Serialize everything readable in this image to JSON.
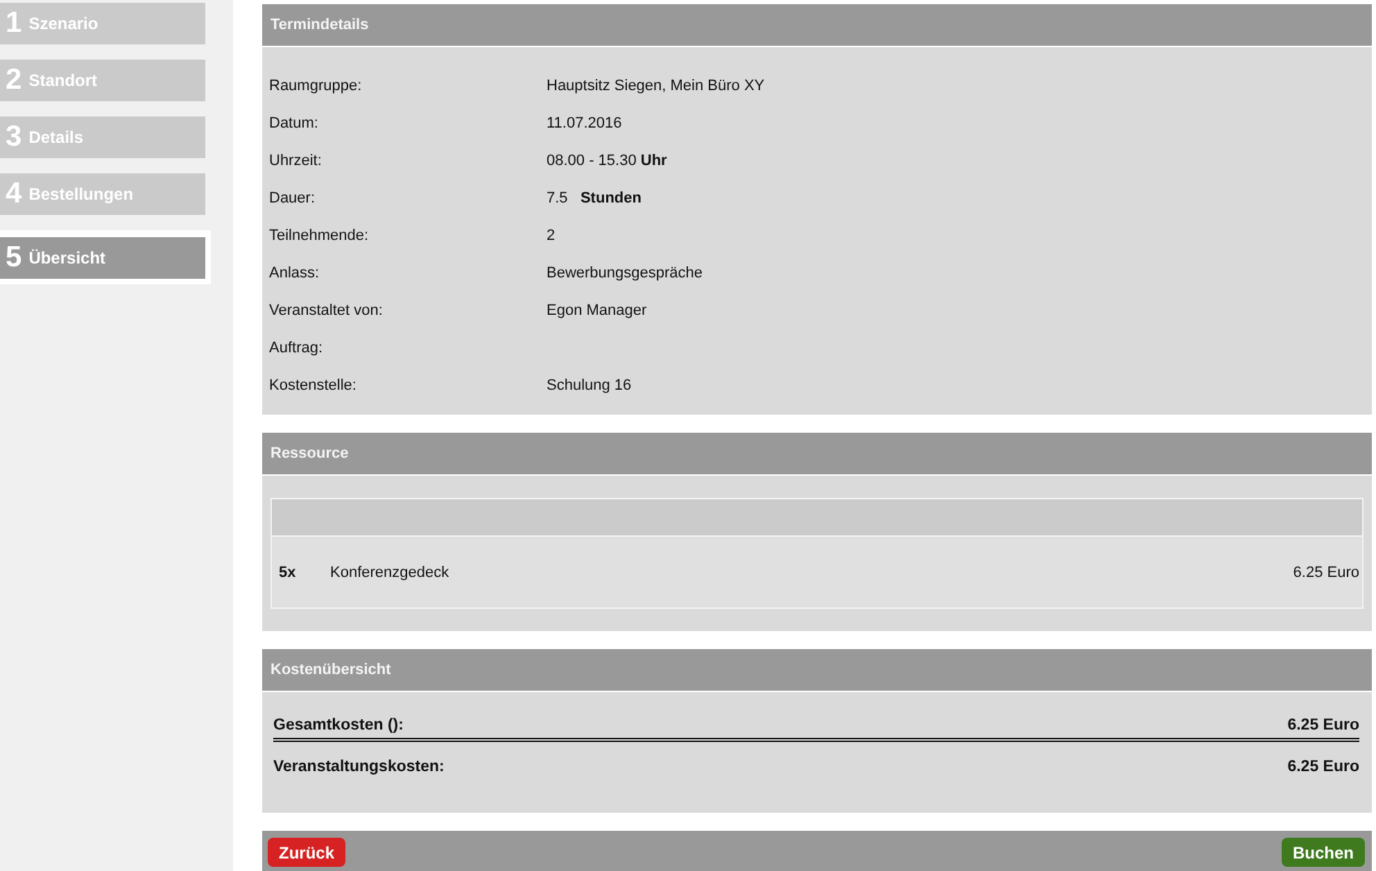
{
  "steps": [
    {
      "number": "1",
      "label": "Szenario",
      "selected": false
    },
    {
      "number": "2",
      "label": "Standort",
      "selected": false
    },
    {
      "number": "3",
      "label": "Details",
      "selected": false
    },
    {
      "number": "4",
      "label": "Bestellungen",
      "selected": false
    },
    {
      "number": "5",
      "label": "Übersicht",
      "selected": true
    }
  ],
  "termindetails": {
    "title": "Termindetails",
    "rows": [
      {
        "label": "Raumgruppe:",
        "value": "Hauptsitz Siegen, Mein Büro XY"
      },
      {
        "label": "Datum:",
        "value": "11.07.2016"
      },
      {
        "label": "Uhrzeit:",
        "value": "08.00 - 15.30 **Uhr**"
      },
      {
        "label": "Dauer:",
        "value": "7.5   **Stunden**"
      },
      {
        "label": "Teilnehmende:",
        "value": "2"
      },
      {
        "label": "Anlass:",
        "value": "Bewerbungsgespräche"
      },
      {
        "label": "Veranstaltet von:",
        "value": "Egon Manager"
      },
      {
        "label": "Auftrag:"
      },
      {
        "label": "Kostenstelle:",
        "value": "Schulung 16"
      }
    ]
  },
  "ressource": {
    "title": "Ressource",
    "items": [
      {
        "quantity": "5x",
        "name": "Konferenzgedeck",
        "price": "6.25 Euro"
      }
    ]
  },
  "kosten": {
    "title": "Kostenübersicht",
    "rows": [
      {
        "label": "Gesamtkosten ():",
        "value": "6.25 Euro"
      },
      {
        "label": "Veranstaltungskosten:",
        "value": "6.25 Euro"
      }
    ]
  },
  "buttons": {
    "back": "Zurück",
    "book": "Buchen"
  }
}
